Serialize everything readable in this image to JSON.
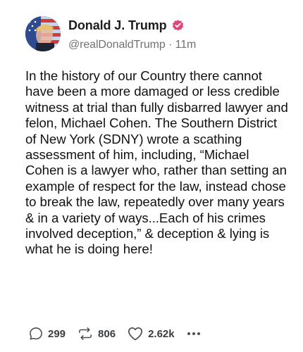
{
  "author": {
    "name": "Donald J. Trump",
    "handle": "@realDonaldTrump",
    "separator": " · ",
    "time": "11m",
    "verified_color": "#e0457b"
  },
  "post": {
    "text": "In the history of our Country there cannot have been a more damaged or less credible witness at trial than fully disbarred lawyer and felon, Michael Cohen. The Southern District of New York (SDNY) wrote a scathing assessment of him,  including, “Michael Cohen is a lawyer who, rather than setting an example of respect for the law, instead chose to break the law, repeatedly over many years & in a variety of ways...Each of his crimes involved deception,” & deception & lying is what he is doing here!"
  },
  "actions": {
    "replies": "299",
    "reposts": "806",
    "likes": "2.62k",
    "reply_icon": "reply-icon",
    "repost_icon": "repost-icon",
    "like_icon": "heart-icon",
    "more_icon": "more-icon"
  }
}
